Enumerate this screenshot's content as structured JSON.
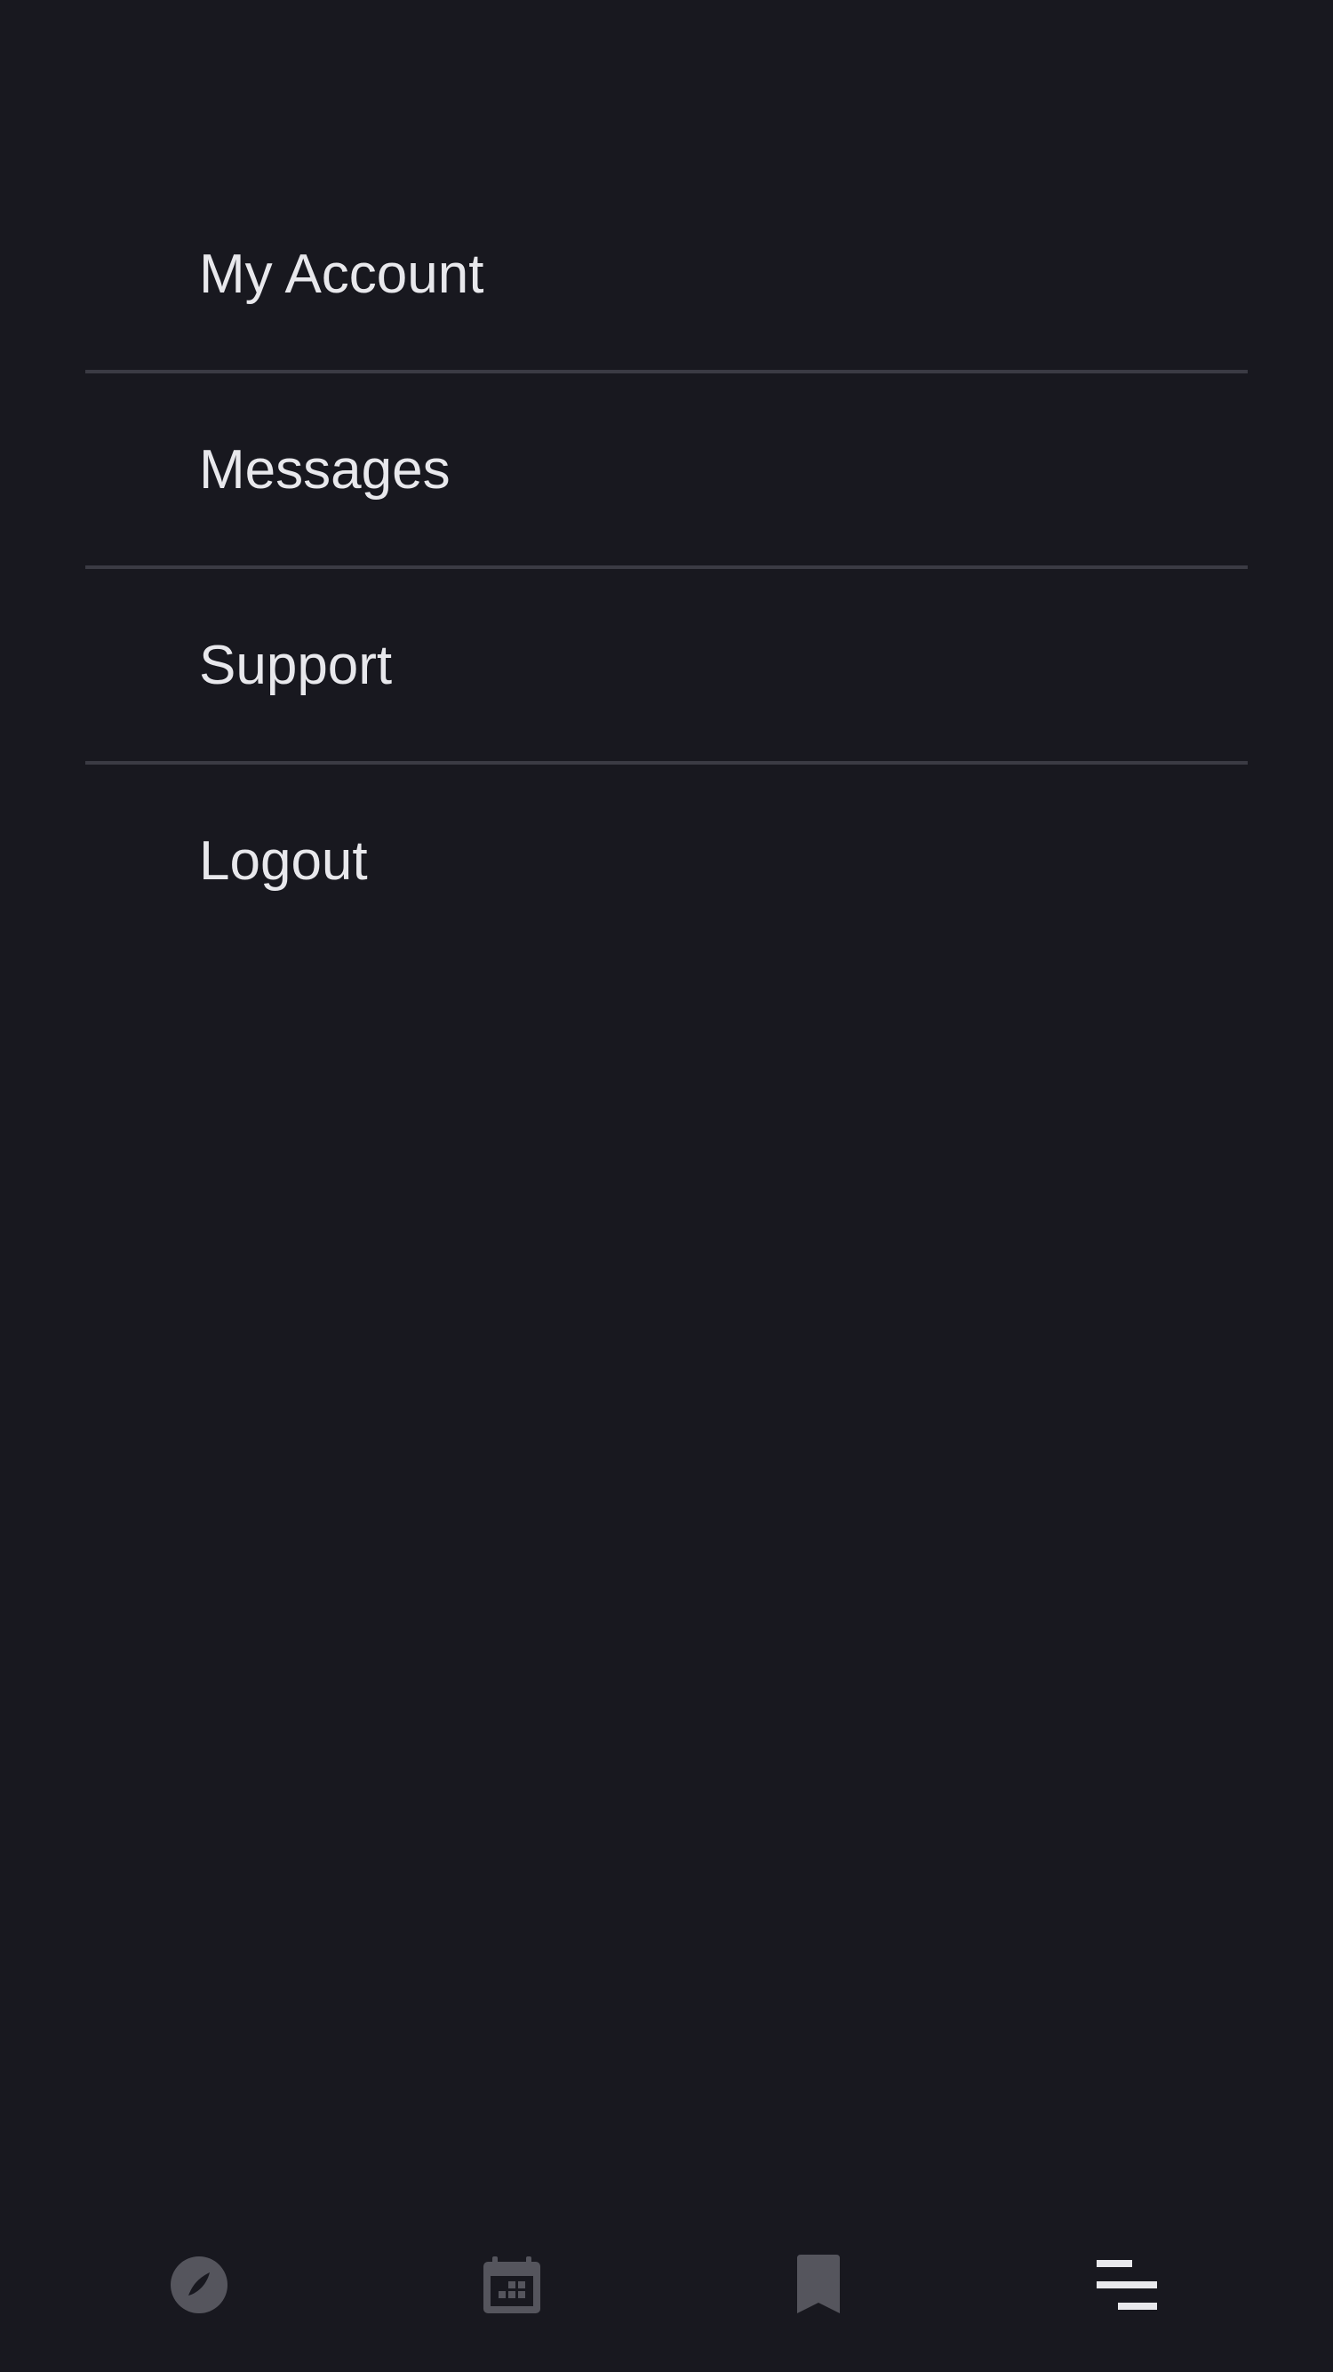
{
  "menu": {
    "items": [
      {
        "label": "My Account"
      },
      {
        "label": "Messages"
      },
      {
        "label": "Support"
      },
      {
        "label": "Logout"
      }
    ]
  },
  "tabbar": {
    "tabs": [
      {
        "icon": "compass-icon",
        "active": false
      },
      {
        "icon": "calendar-icon",
        "active": false
      },
      {
        "icon": "bookmark-icon",
        "active": false
      },
      {
        "icon": "menu-icon",
        "active": true
      }
    ]
  },
  "colors": {
    "background": "#18181f",
    "text": "#e8e8ec",
    "divider": "#3b3b44",
    "icon_inactive": "#55555d",
    "icon_active": "#e8e8ec"
  }
}
